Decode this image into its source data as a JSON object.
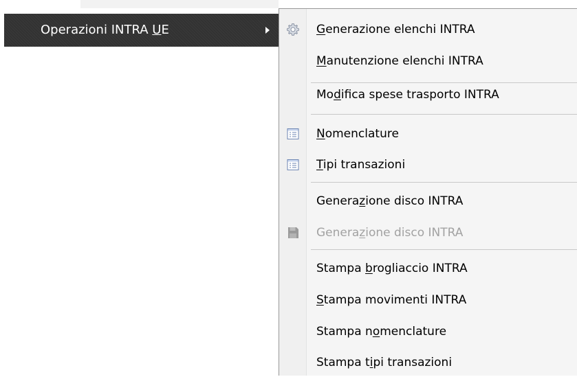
{
  "parent_menu": {
    "item": {
      "label_before": "Operazioni INTRA ",
      "label_mnemonic": "U",
      "label_after": "E"
    }
  },
  "submenu": {
    "items": [
      {
        "before": "",
        "mnemonic": "G",
        "after": "enerazione elenchi INTRA",
        "icon": "gear-icon",
        "disabled": false
      },
      {
        "before": "",
        "mnemonic": "M",
        "after": "anutenzione elenchi INTRA",
        "icon": "",
        "disabled": false
      },
      {
        "before": "Mo",
        "mnemonic": "d",
        "after": "ifica spese trasporto INTRA",
        "icon": "",
        "disabled": false
      },
      {
        "before": "",
        "mnemonic": "N",
        "after": "omenclature",
        "icon": "list-icon",
        "disabled": false
      },
      {
        "before": "",
        "mnemonic": "T",
        "after": "ipi transazioni",
        "icon": "list-icon",
        "disabled": false
      },
      {
        "before": "Genera",
        "mnemonic": "z",
        "after": "ione disco INTRA",
        "icon": "",
        "disabled": false
      },
      {
        "before": "Genera",
        "mnemonic": "z",
        "after": "ione disco INTRA",
        "icon": "floppy-disk-icon",
        "disabled": true
      },
      {
        "before": "Stampa ",
        "mnemonic": "b",
        "after": "rogliaccio INTRA",
        "icon": "",
        "disabled": false
      },
      {
        "before": "",
        "mnemonic": "S",
        "after": "tampa movimenti INTRA",
        "icon": "",
        "disabled": false
      },
      {
        "before": "Stampa n",
        "mnemonic": "o",
        "after": "menclature",
        "icon": "",
        "disabled": false
      },
      {
        "before": "Stampa t",
        "mnemonic": "i",
        "after": "pi transazioni",
        "icon": "",
        "disabled": false
      }
    ]
  }
}
